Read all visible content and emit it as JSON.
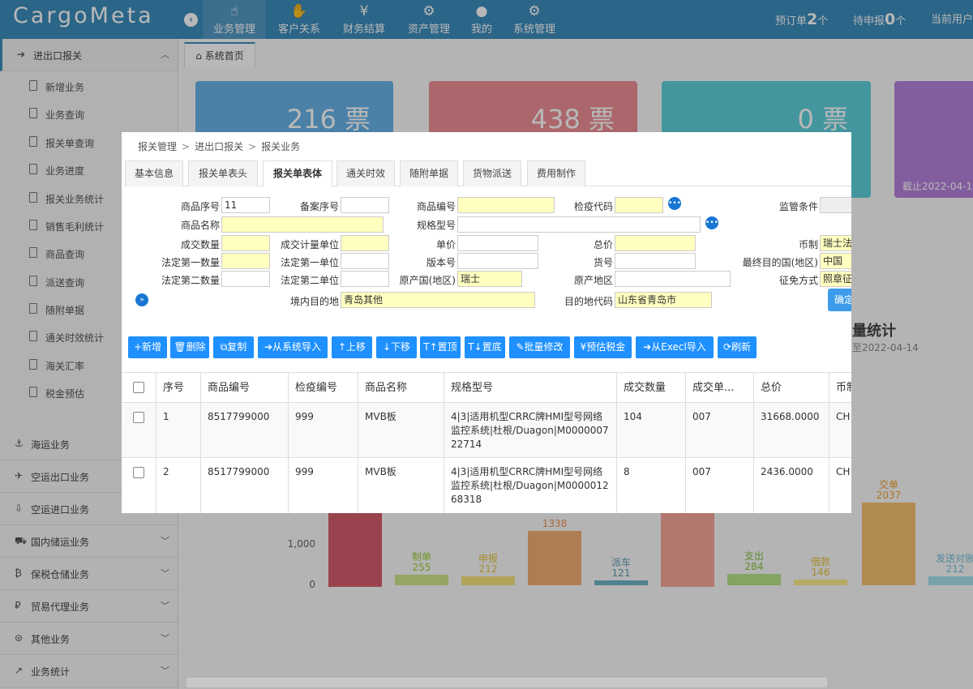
{
  "app": {
    "logo": "CargoMeta"
  },
  "topnav": [
    {
      "label": "业务管理",
      "icon": "☝",
      "active": true
    },
    {
      "label": "客户关系",
      "icon": "✋"
    },
    {
      "label": "财务结算",
      "icon": "¥"
    },
    {
      "label": "资产管理",
      "icon": "⚙"
    },
    {
      "label": "我的",
      "icon": "●"
    },
    {
      "label": "系统管理",
      "icon": "⚙"
    }
  ],
  "header_stats": {
    "booking_label": "预订单",
    "booking_count": "2",
    "booking_unit": "个",
    "pending_label": "待申报",
    "pending_count": "0",
    "pending_unit": "个",
    "current_user_label": "当前用户"
  },
  "sidebar": {
    "first": {
      "label": "进出口报关",
      "icon": "➔"
    },
    "subitems": [
      "新增业务",
      "业务查询",
      "报关单查询",
      "业务进度",
      "报关业务统计",
      "销售毛利统计",
      "商品查询",
      "派送查询",
      "随附单据",
      "通关时效统计",
      "海关汇率",
      "税金预估"
    ],
    "sections": [
      {
        "label": "海运业务",
        "icon": "⚓"
      },
      {
        "label": "空运出口业务",
        "icon": "✈"
      },
      {
        "label": "空运进口业务",
        "icon": "⇩"
      },
      {
        "label": "国内储运业务",
        "icon": "⛟"
      },
      {
        "label": "保税仓储业务",
        "icon": "₿"
      },
      {
        "label": "贸易代理业务",
        "icon": "₽"
      },
      {
        "label": "其他业务",
        "icon": "⊜"
      },
      {
        "label": "业务统计",
        "icon": "↗"
      }
    ]
  },
  "page_tab": "系统首页",
  "cards": [
    {
      "value": "216 票"
    },
    {
      "value": "438 票"
    },
    {
      "value": "0 票"
    },
    {
      "value": "",
      "sub": "截止2022-04-1"
    }
  ],
  "stat_panel": {
    "title": "量统计",
    "date": "至2022-04-14"
  },
  "chart_data": {
    "type": "bar",
    "categories": [
      "",
      "制单",
      "申报",
      "",
      "派车",
      "",
      "支出",
      "借款",
      "交单",
      "发送对账"
    ],
    "values": [
      null,
      255,
      212,
      1338,
      121,
      null,
      284,
      146,
      2037,
      212
    ],
    "yticks": [
      "1,000",
      "0"
    ],
    "ylim": [
      0,
      2200
    ]
  },
  "dialog": {
    "breadcrumb": [
      "报关管理",
      "进出口报关",
      "报关业务"
    ],
    "tabs": [
      "基本信息",
      "报关单表头",
      "报关单表体",
      "通关时效",
      "随附单据",
      "货物派送",
      "费用制作"
    ],
    "active_tab": 2,
    "form": {
      "goods_seq": {
        "label": "商品序号",
        "value": "11"
      },
      "record_seq": {
        "label": "备案序号",
        "value": ""
      },
      "goods_code": {
        "label": "商品编号",
        "value": ""
      },
      "quarantine_code": {
        "label": "检疫代码",
        "value": ""
      },
      "supervision": {
        "label": "监管条件",
        "value": ""
      },
      "goods_name": {
        "label": "商品名称",
        "value": ""
      },
      "spec_model": {
        "label": "规格型号",
        "value": ""
      },
      "deal_qty": {
        "label": "成交数量",
        "value": ""
      },
      "deal_unit": {
        "label": "成交计量单位",
        "value": ""
      },
      "unit_price": {
        "label": "单价",
        "value": ""
      },
      "total_price": {
        "label": "总价",
        "value": ""
      },
      "currency": {
        "label": "币制",
        "value": "瑞士法"
      },
      "legal_qty1": {
        "label": "法定第一数量",
        "value": ""
      },
      "legal_unit1": {
        "label": "法定第一单位",
        "value": ""
      },
      "version_no": {
        "label": "版本号",
        "value": ""
      },
      "item_no": {
        "label": "货号",
        "value": ""
      },
      "final_dest": {
        "label": "最终目的国(地区)",
        "value": "中国"
      },
      "legal_qty2": {
        "label": "法定第二数量",
        "value": ""
      },
      "legal_unit2": {
        "label": "法定第二单位",
        "value": ""
      },
      "origin_country": {
        "label": "原产国(地区)",
        "value": "瑞士"
      },
      "origin_area": {
        "label": "原产地区",
        "value": ""
      },
      "levy_mode": {
        "label": "征免方式",
        "value": "照章征"
      },
      "domestic_dest": {
        "label": "境内目的地",
        "value": "青岛其他"
      },
      "dest_code": {
        "label": "目的地代码",
        "value": "山东省青岛市"
      },
      "confirm": "确定"
    },
    "toolbar": [
      {
        "label": "+新增",
        "w": 48
      },
      {
        "label": "🗑删除",
        "w": 52
      },
      {
        "label": "⧉复制",
        "w": 52
      },
      {
        "label": "➔从系统导入",
        "w": 90
      },
      {
        "label": "↑上移",
        "w": 52
      },
      {
        "label": "↓下移",
        "w": 52
      },
      {
        "label": "T↑置顶",
        "w": 52
      },
      {
        "label": "T↓置底",
        "w": 52
      },
      {
        "label": "✎批量修改",
        "w": 76
      },
      {
        "label": "¥预估税金",
        "w": 72
      },
      {
        "label": "➔从Execl导入",
        "w": 96
      },
      {
        "label": "⟳刷新",
        "w": 48
      }
    ],
    "table": {
      "headers": [
        "序号",
        "商品编号",
        "检疫编号",
        "商品名称",
        "规格型号",
        "成交数量",
        "成交单...",
        "总价",
        "币制"
      ],
      "rows": [
        {
          "seq": "1",
          "code": "8517799000",
          "quarantine": "999",
          "name": "MVB板",
          "spec": "4|3|适用机型CRRC牌HMI型号网络监控系统|杜根/Duagon|M000000722714",
          "qty": "104",
          "unit": "007",
          "total": "31668.0000",
          "currency": "CH"
        },
        {
          "seq": "2",
          "code": "8517799000",
          "quarantine": "999",
          "name": "MVB板",
          "spec": "4|3|适用机型CRRC牌HMI型号网络监控系统|杜根/Duagon|M000001268318",
          "qty": "8",
          "unit": "007",
          "total": "2436.0000",
          "currency": "CH"
        }
      ]
    }
  }
}
